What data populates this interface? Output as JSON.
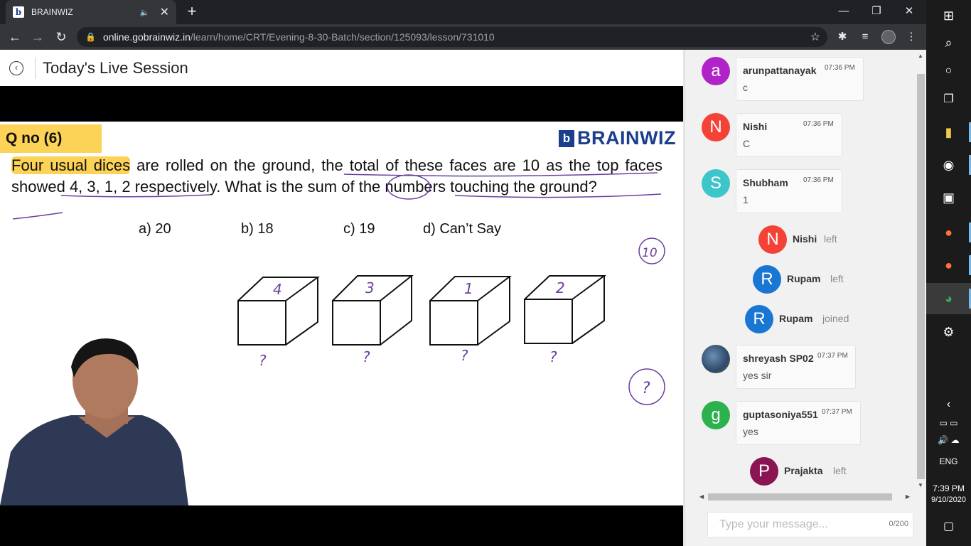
{
  "browser": {
    "tab_title": "BRAINWIZ",
    "tab_favicon": "b",
    "tab_audio_icon": "🔈",
    "close_glyph": "✕",
    "newtab_glyph": "+",
    "url_host": "online.gobrainwiz.in",
    "url_path": "/learn/home/CRT/Evening-8-30-Batch/section/125093/lesson/731010",
    "window_controls": {
      "minimize": "—",
      "maximize": "❐",
      "close": "✕"
    },
    "nav": {
      "back": "←",
      "forward": "→",
      "reload": "↻",
      "lock": "🔒",
      "star": "☆"
    },
    "toolbar_icons": {
      "extensions": "✱",
      "media": "≡",
      "menu": "⋮"
    }
  },
  "page": {
    "title": "Today's Live Session",
    "back_glyph": "‹"
  },
  "slide": {
    "qno": "Q no (6)",
    "logo_mark": "b",
    "logo_text": "BRAINWIZ",
    "question_highlight": "Four usual dices",
    "question_rest": " are rolled on the ground, the total of these faces are 10 as the top faces showed 4, 3, 1, 2 respectively. What is the sum of the numbers touching the ground?",
    "options": [
      "a) 20",
      "b) 18",
      "c) 19",
      "d) Can’t Say"
    ],
    "dice_top_numbers": [
      "4",
      "3",
      "1",
      "2"
    ],
    "annotations": {
      "circled_total": "10",
      "question_mark": "?"
    }
  },
  "chat": {
    "messages": [
      {
        "type": "message",
        "initial": "a",
        "color": "#b023c9",
        "name": "arunpattanayak",
        "time": "07:36 PM",
        "text": "c"
      },
      {
        "type": "message",
        "initial": "N",
        "color": "#f44336",
        "name": "Nishi",
        "time": "07:36 PM",
        "text": "C"
      },
      {
        "type": "message",
        "initial": "S",
        "color": "#3cc6c9",
        "name": "Shubham",
        "time": "07:36 PM",
        "text": "1"
      },
      {
        "type": "event",
        "initial": "N",
        "color": "#f44336",
        "name": "Nishi",
        "action": "left"
      },
      {
        "type": "event",
        "initial": "R",
        "color": "#1976d2",
        "name": "Rupam",
        "action": "left"
      },
      {
        "type": "event",
        "initial": "R",
        "color": "#1976d2",
        "name": "Rupam",
        "action": "joined"
      },
      {
        "type": "message",
        "initial": "",
        "color": "#2f4a6a",
        "name": "shreyash SP02",
        "time": "07:37 PM",
        "text": "yes sir"
      },
      {
        "type": "message",
        "initial": "g",
        "color": "#2bb24c",
        "name": "guptasoniya551",
        "time": "07:37 PM",
        "text": "yes"
      },
      {
        "type": "event",
        "initial": "P",
        "color": "#8b1452",
        "name": "Prajakta",
        "action": "left"
      }
    ],
    "input_placeholder": "Type your message...",
    "counter": "0/200"
  },
  "taskbar": {
    "clock_time": "7:39 PM",
    "clock_date": "9/10/2020",
    "language": "ENG"
  }
}
